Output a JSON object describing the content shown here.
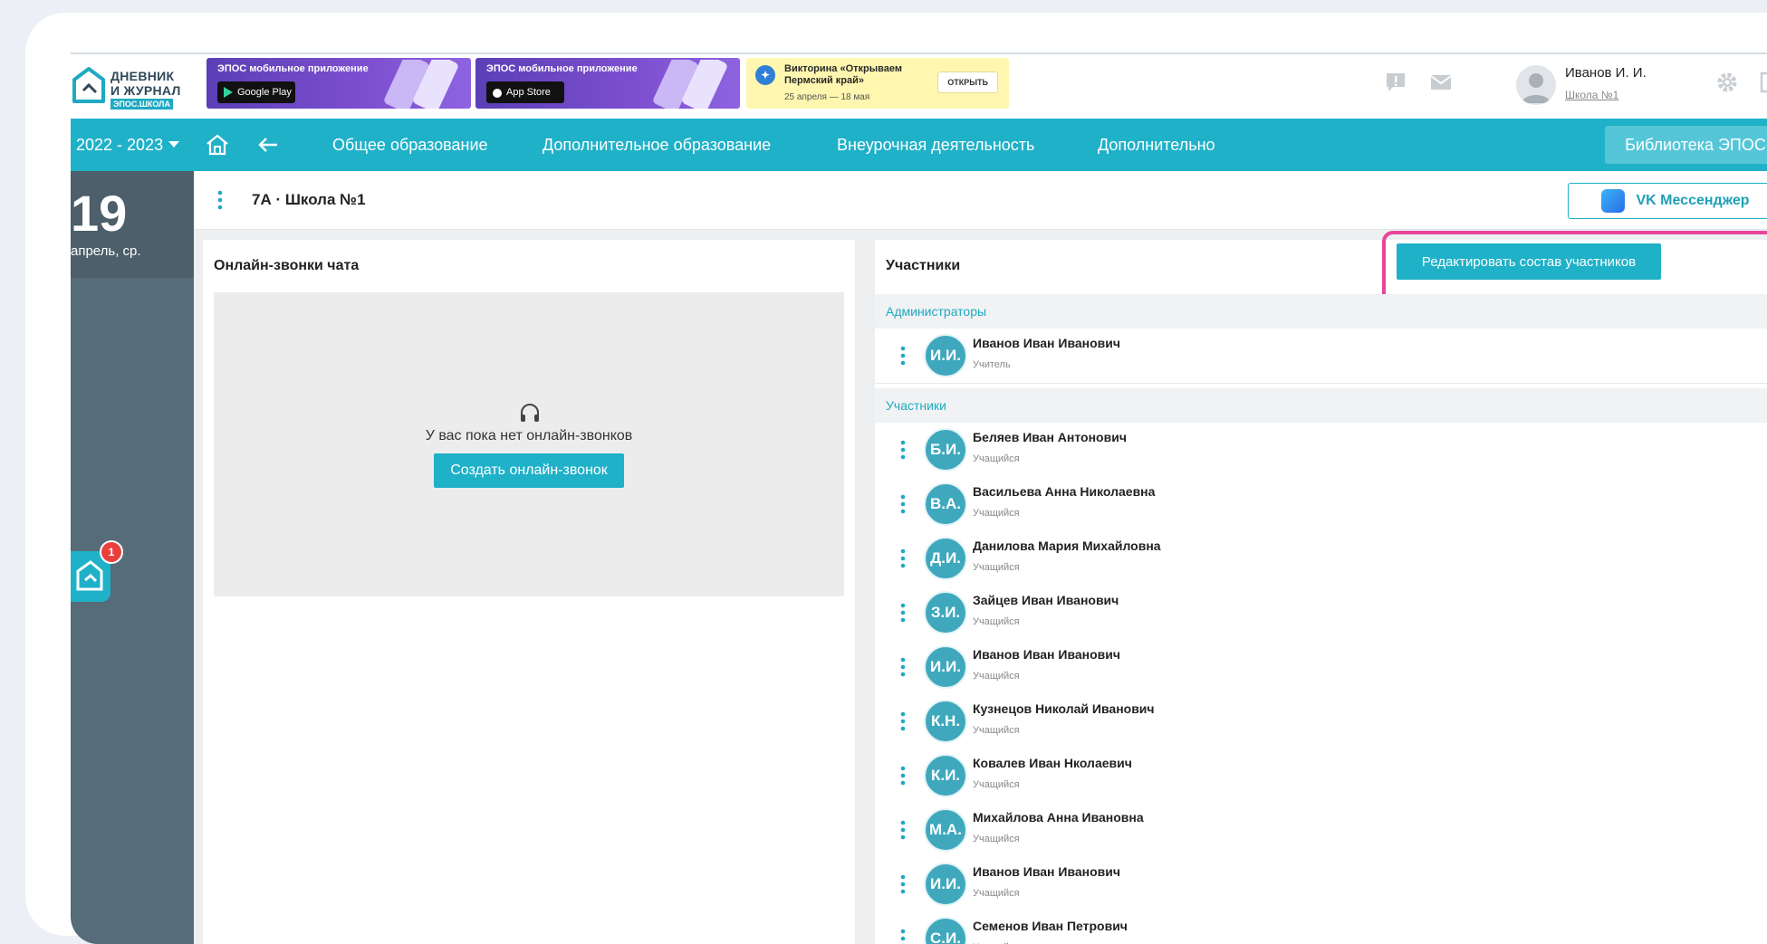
{
  "header": {
    "logo": {
      "line1": "ДНЕВНИК",
      "line2": "И ЖУРНАЛ",
      "line3": "ЭПОС.ШКОЛА"
    },
    "banners": [
      {
        "caption": "ЭПОС мобильное приложение",
        "store": "Google Play"
      },
      {
        "caption": "ЭПОС мобильное приложение",
        "store": "App Store"
      }
    ],
    "quiz": {
      "title": "Викторина «Открываем Пермский край»",
      "dates": "25 апреля — 18 мая",
      "button": "ОТКРЫТЬ"
    },
    "user": {
      "name": "Иванов И. И.",
      "school": "Школа №1"
    }
  },
  "nav": {
    "year": "2022 - 2023",
    "items": [
      "Общее образование",
      "Дополнительное образование",
      "Внеурочная деятельность",
      "Дополнительно"
    ],
    "library": "Библиотека ЭПОС"
  },
  "sidebar": {
    "day": "19",
    "date_sub": "апрель, ср.",
    "badge": "1"
  },
  "chat": {
    "title": "7А · Школа №1",
    "vk_button": "VK Мессенджер"
  },
  "calls": {
    "title": "Онлайн-звонки чата",
    "empty_text": "У вас пока нет онлайн-звонков",
    "create_button": "Создать онлайн-звонок"
  },
  "participants": {
    "title": "Участники",
    "edit_button": "Редактировать состав участников",
    "admins_label": "Администраторы",
    "admins": [
      {
        "initials": "И.И.",
        "name": "Иванов Иван Иванович",
        "role": "Учитель"
      }
    ],
    "members_label": "Участники",
    "members": [
      {
        "initials": "Б.И.",
        "name": "Беляев Иван Антонович",
        "role": "Учащийся"
      },
      {
        "initials": "В.А.",
        "name": "Васильева Анна Николаевна",
        "role": "Учащийся"
      },
      {
        "initials": "Д.И.",
        "name": "Данилова Мария Михайловна",
        "role": "Учащийся"
      },
      {
        "initials": "З.И.",
        "name": "Зайцев Иван Иванович",
        "role": "Учащийся"
      },
      {
        "initials": "И.И.",
        "name": "Иванов Иван Иванович",
        "role": "Учащийся"
      },
      {
        "initials": "К.Н.",
        "name": "Кузнецов Николай Иванович",
        "role": "Учащийся"
      },
      {
        "initials": "К.И.",
        "name": "Ковалев Иван Нколаевич",
        "role": "Учащийся"
      },
      {
        "initials": "М.А.",
        "name": "Михайлова Анна Ивановна",
        "role": "Учащийся"
      },
      {
        "initials": "И.И.",
        "name": "Иванов Иван Иванович",
        "role": "Учащийся"
      },
      {
        "initials": "С.И.",
        "name": "Семенов Иван Петрович",
        "role": "Учащийся"
      }
    ]
  },
  "colors": {
    "accent": "#1fb1c8",
    "sidebar": "#566c78",
    "highlight": "#e8459a"
  }
}
